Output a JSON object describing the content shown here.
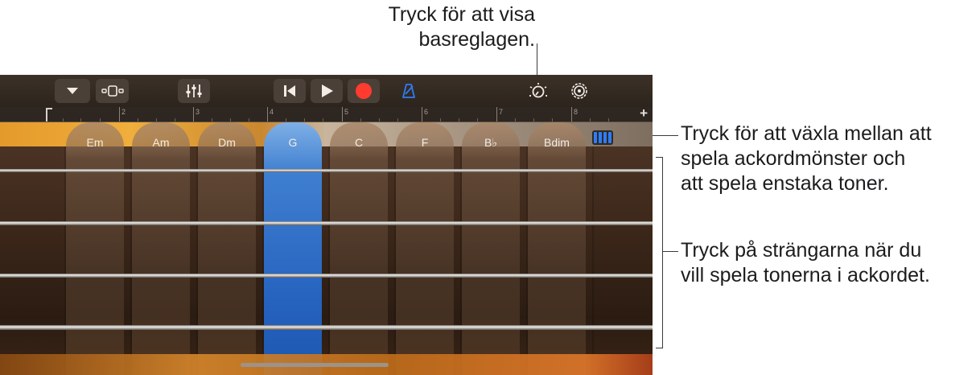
{
  "callouts": {
    "top": [
      "Tryck för att visa",
      "basreglagen."
    ],
    "mode_toggle": [
      "Tryck för att växla mellan att",
      "spela ackordmönster och",
      "att spela enstaka toner."
    ],
    "strings": [
      "Tryck på strängarna när du",
      "vill spela tonerna i ackordet."
    ]
  },
  "ruler": {
    "bars": [
      "2",
      "3",
      "4",
      "5",
      "6",
      "7",
      "8"
    ],
    "plus": "+"
  },
  "chords": [
    {
      "label": "Em",
      "active": false
    },
    {
      "label": "Am",
      "active": false
    },
    {
      "label": "Dm",
      "active": false
    },
    {
      "label": "G",
      "active": true
    },
    {
      "label": "C",
      "active": false
    },
    {
      "label": "F",
      "active": false
    },
    {
      "label": "B♭",
      "active": false
    },
    {
      "label": "Bdim",
      "active": false
    }
  ],
  "toolbar_icons": [
    "dropdown-icon",
    "view-toggle-icon",
    "mixer-icon",
    "skip-back-icon",
    "play-icon",
    "record-icon",
    "metronome-icon",
    "bass-controls-icon",
    "settings-icon"
  ],
  "colors": {
    "record": "#ff3b30",
    "accent_blue": "#2f7cf6",
    "active_chord": "#2663bf"
  }
}
